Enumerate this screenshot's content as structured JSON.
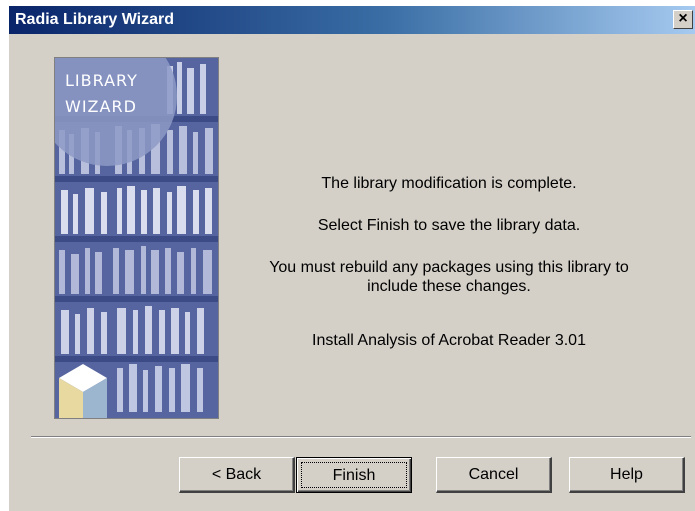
{
  "window": {
    "title": "Radia Library Wizard",
    "close_glyph": "×"
  },
  "image": {
    "caption_line1": "LIBRARY",
    "caption_line2": "WIZARD"
  },
  "messages": {
    "line1": "The library modification is complete.",
    "line2": "Select Finish to save the library data.",
    "line3": "You must rebuild any packages using this library to include these changes.",
    "line4": "Install Analysis of Acrobat Reader 3.01"
  },
  "buttons": {
    "back": "< Back",
    "finish": "Finish",
    "cancel": "Cancel",
    "help": "Help"
  }
}
